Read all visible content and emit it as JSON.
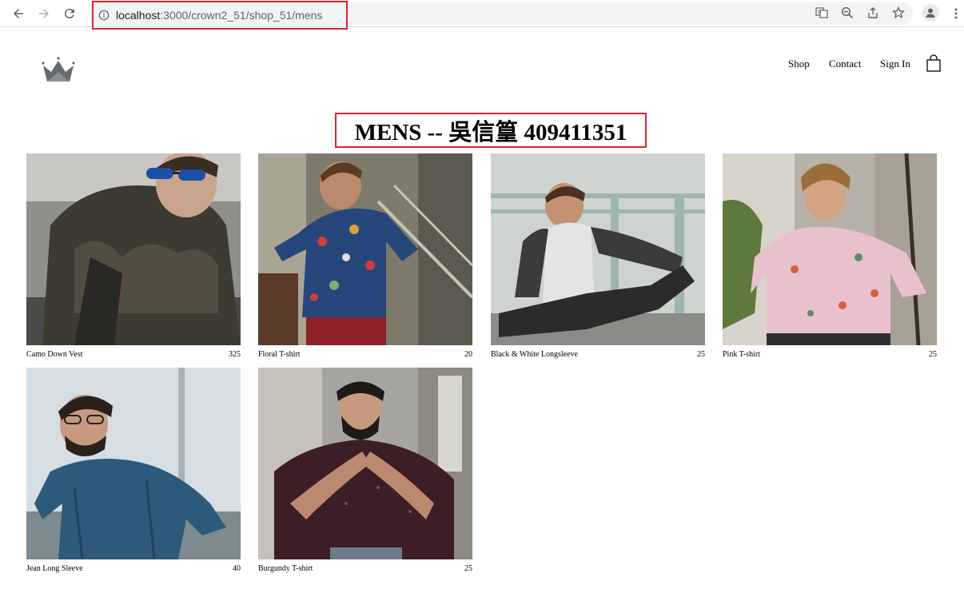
{
  "browser": {
    "url_host": "localhost",
    "url_path": ":3000/crown2_51/shop_51/mens",
    "highlight_color": "#d9262c"
  },
  "header": {
    "logo_icon": "crown-icon",
    "nav": {
      "shop": "Shop",
      "contact": "Contact",
      "sign_in": "Sign In"
    },
    "cart_icon": "shopping-bag-icon"
  },
  "page": {
    "title": "MENS -- 吳信篁 409411351"
  },
  "products": [
    {
      "name": "Camo Down Vest",
      "price": "325"
    },
    {
      "name": "Floral T-shirt",
      "price": "20"
    },
    {
      "name": "Black & White Longsleeve",
      "price": "25"
    },
    {
      "name": "Pink T-shirt",
      "price": "25"
    },
    {
      "name": "Jean Long Sleeve",
      "price": "40"
    },
    {
      "name": "Burgundy T-shirt",
      "price": "25"
    }
  ]
}
